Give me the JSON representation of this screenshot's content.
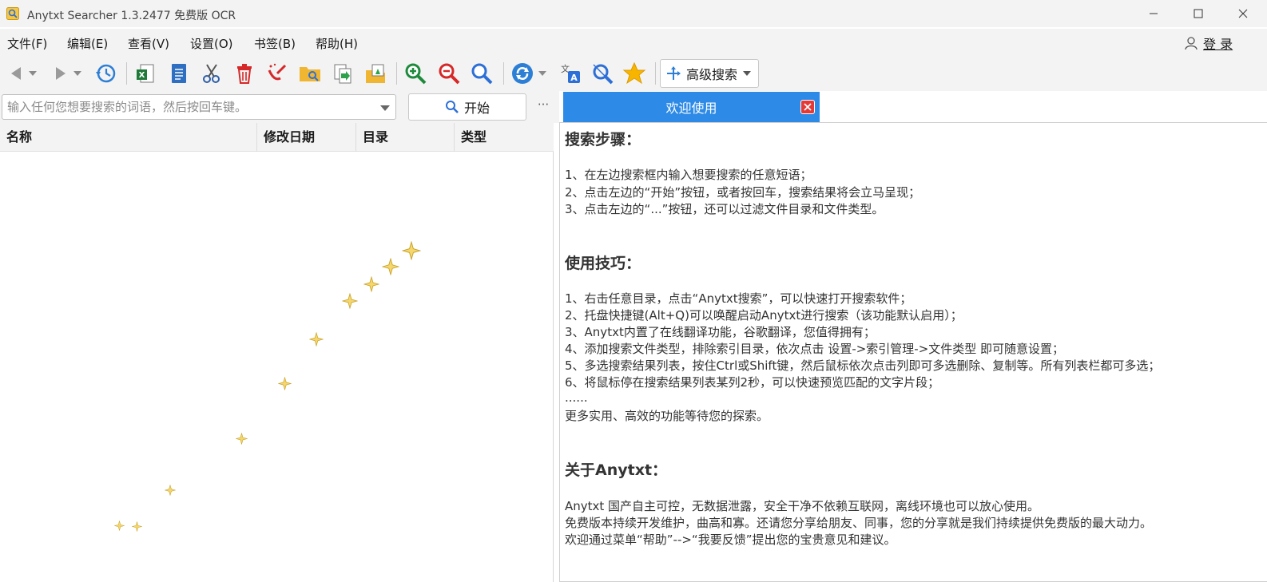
{
  "window": {
    "title": "Anytxt Searcher 1.3.2477 免费版 OCR"
  },
  "menu": {
    "items": [
      "文件(F)",
      "编辑(E)",
      "查看(V)",
      "设置(O)",
      "书签(B)",
      "帮助(H)"
    ],
    "login_label": "登 录"
  },
  "toolbar": {
    "advanced_search_label": "高级搜索",
    "icons": [
      "back-icon",
      "forward-icon",
      "history-icon",
      "excel-export-icon",
      "document-icon",
      "cut-icon",
      "delete-icon",
      "clean-icon",
      "open-folder-icon",
      "copy-to-icon",
      "move-to-icon",
      "zoom-in-icon",
      "zoom-out-icon",
      "find-icon",
      "refresh-icon",
      "translate-icon",
      "ocr-icon",
      "bookmark-star-icon"
    ]
  },
  "search": {
    "placeholder": "输入任何您想要搜索的词语，然后按回车键。",
    "start_label": "开始",
    "more_label": "···"
  },
  "table": {
    "columns": [
      "名称",
      "修改日期",
      "目录",
      "类型"
    ]
  },
  "tab": {
    "label": "欢迎使用"
  },
  "welcome": {
    "steps_title": "搜索步骤：",
    "steps": [
      "1、在左边搜索框内输入想要搜索的任意短语；",
      "2、点击左边的“开始”按钮，或者按回车，搜索结果将会立马呈现；",
      "3、点击左边的“...”按钮，还可以过滤文件目录和文件类型。"
    ],
    "tips_title": "使用技巧：",
    "tips": [
      "1、右击任意目录，点击“Anytxt搜索”，可以快速打开搜索软件；",
      "2、托盘快捷键(Alt+Q)可以唤醒启动Anytxt进行搜索（该功能默认启用）；",
      "3、Anytxt内置了在线翻译功能，谷歌翻译，您值得拥有；",
      "4、添加搜索文件类型，排除索引目录，依次点击 设置->索引管理->文件类型 即可随意设置；",
      "5、多选搜索结果列表，按住Ctrl或Shift键，然后鼠标依次点击列即可多选删除、复制等。所有列表栏都可多选；",
      "6、将鼠标停在搜索结果列表某列2秒，可以快速预览匹配的文字片段；",
      "......",
      "更多实用、高效的功能等待您的探索。"
    ],
    "about_title": "关于Anytxt：",
    "about": [
      "Anytxt 国产自主可控，无数据泄露，安全干净不依赖互联网，离线环境也可以放心使用。",
      "免费版本持续开发维护，曲高和寡。还请您分享给朋友、同事，您的分享就是我们持续提供免费版的最大动力。",
      "欢迎通过菜单“帮助”-->“我要反馈”提出您的宝贵意见和建议。"
    ]
  },
  "colors": {
    "tab_accent": "#2d8ae6",
    "close_red": "#e53935",
    "chrome_bg": "#f3f3f3"
  }
}
